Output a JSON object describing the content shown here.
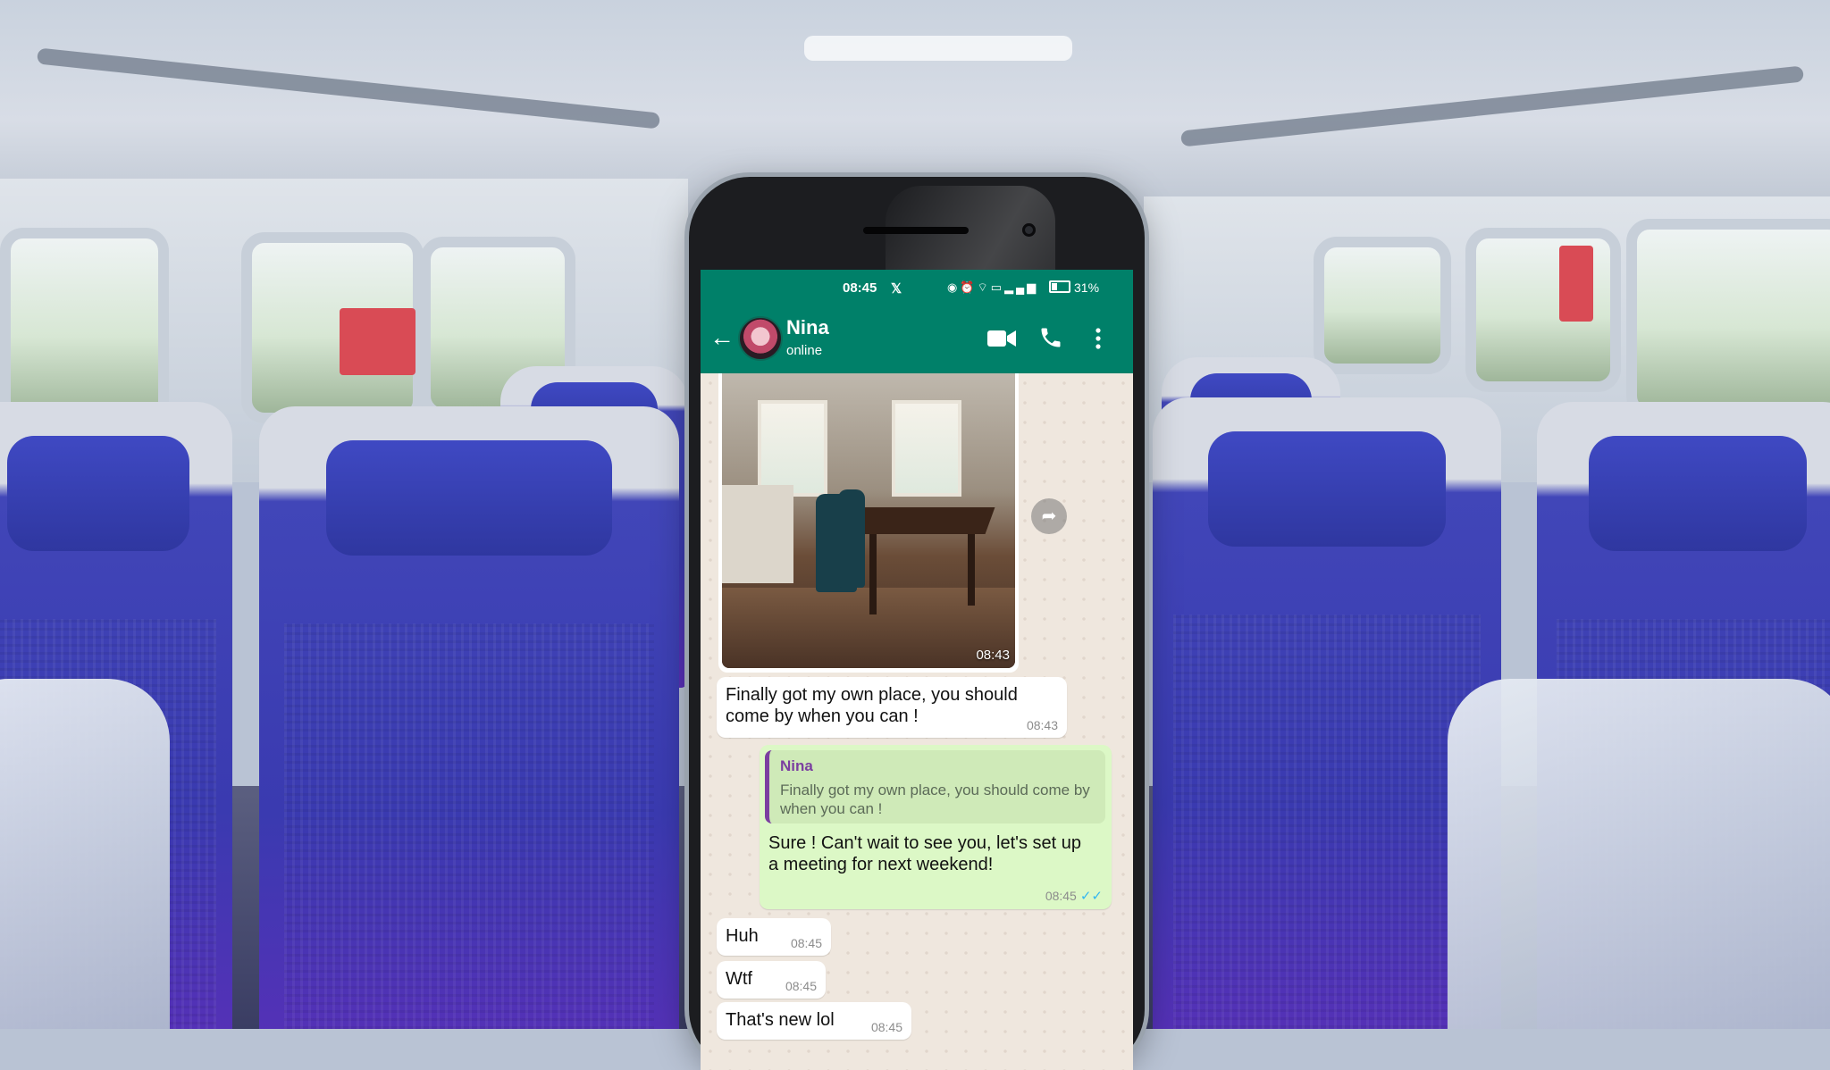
{
  "status_bar": {
    "time": "08:45",
    "x_glyph": "𝕏",
    "icons": [
      "eye-icon",
      "alarm-icon",
      "wifi-icon",
      "lte-icon",
      "signal-icon"
    ],
    "battery": "31%"
  },
  "header": {
    "back_icon": "arrow-back-icon",
    "contact_name": "Nina",
    "presence": "online",
    "actions": [
      "video-call-icon",
      "phone-call-icon",
      "more-vert-icon"
    ],
    "color": "#008069"
  },
  "messages": {
    "image": {
      "timestamp": "08:43"
    },
    "m1": {
      "text": "Finally got my own place, you should come by when you can !",
      "time": "08:43"
    },
    "m2": {
      "quote_name": "Nina",
      "quote_text": "Finally got my own place, you should come by when you can !",
      "text": "Sure ! Can't wait to see you, let's set up a meeting for next weekend!",
      "time": "08:45",
      "ticks": "✓✓"
    },
    "m3": {
      "text": "Huh",
      "time": "08:45"
    },
    "m4": {
      "text": "Wtf",
      "time": "08:45"
    },
    "m5": {
      "text": "That's new lol",
      "time": "08:45"
    }
  },
  "colors": {
    "incoming_bubble": "#ffffff",
    "outgoing_bubble": "#dcf8c6",
    "quote_accent": "#7b3fa0",
    "read_ticks": "#34b7f1"
  }
}
